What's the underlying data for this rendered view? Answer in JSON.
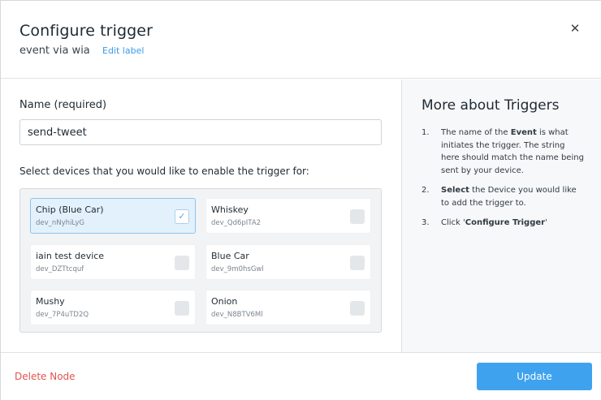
{
  "modal": {
    "title": "Configure trigger",
    "subtitle": "event via wia",
    "edit_label": "Edit label",
    "close_glyph": "✕"
  },
  "form": {
    "name_label": "Name (required)",
    "name_value": "send-tweet",
    "select_label": "Select devices that you would like to enable the trigger for:"
  },
  "devices": [
    {
      "name": "Chip (Blue Car)",
      "id": "dev_nNyhiLyG",
      "selected": true
    },
    {
      "name": "Whiskey",
      "id": "dev_Qd6pITA2",
      "selected": false
    },
    {
      "name": "iain test device",
      "id": "dev_DZTtcquf",
      "selected": false
    },
    {
      "name": "Blue Car",
      "id": "dev_9m0hsGwl",
      "selected": false
    },
    {
      "name": "Mushy",
      "id": "dev_7P4uTD2Q",
      "selected": false
    },
    {
      "name": "Onion",
      "id": "dev_N8BTV6Ml",
      "selected": false
    }
  ],
  "sidebar": {
    "title": "More about Triggers",
    "steps": [
      {
        "num": "1.",
        "pre": "The name of the ",
        "bold": "Event",
        "post": " is what initiates the trigger. The string here should match the name being sent by your device."
      },
      {
        "num": "2.",
        "pre": "",
        "bold": "Select",
        "post": " the Device you would like to add the trigger to."
      },
      {
        "num": "3.",
        "pre": "Click '",
        "bold": "Configure Trigger",
        "post": "'"
      }
    ]
  },
  "footer": {
    "delete_label": "Delete Node",
    "update_label": "Update"
  },
  "colors": {
    "accent": "#3fa2ef",
    "danger": "#e0544f",
    "selected_bg": "#e3f1fc"
  }
}
